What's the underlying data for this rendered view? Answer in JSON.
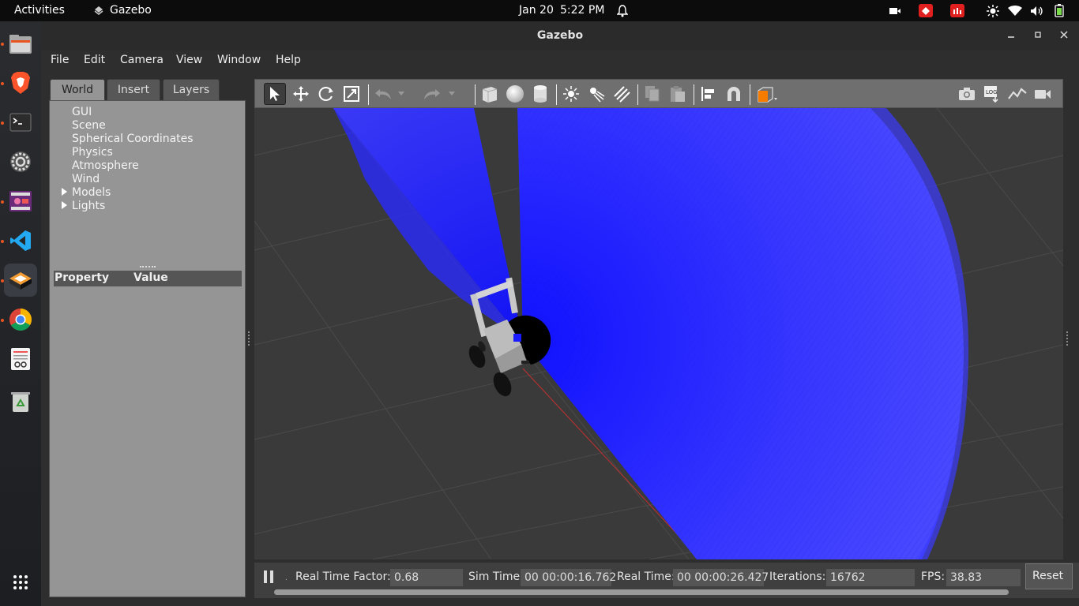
{
  "topbar": {
    "activities": "Activities",
    "app_name": "Gazebo",
    "date": "Jan 20",
    "time": "5:22 PM"
  },
  "window": {
    "title": "Gazebo"
  },
  "menu": {
    "file": "File",
    "edit": "Edit",
    "camera": "Camera",
    "view": "View",
    "window": "Window",
    "help": "Help"
  },
  "tabs": {
    "world": "World",
    "insert": "Insert",
    "layers": "Layers"
  },
  "tree": {
    "gui": "GUI",
    "scene": "Scene",
    "spherical": "Spherical Coordinates",
    "physics": "Physics",
    "atmosphere": "Atmosphere",
    "wind": "Wind",
    "models": "Models",
    "lights": "Lights"
  },
  "properties": {
    "property": "Property",
    "value": "Value"
  },
  "status": {
    "rtf_label": "Real Time Factor:",
    "rtf_value": "0.68",
    "sim_label": "Sim Time:",
    "sim_value": "00 00:00:16.762",
    "real_label": "Real Time:",
    "real_value": "00 00:00:26.427",
    "iter_label": "Iterations:",
    "iter_value": "16762",
    "fps_label": "FPS:",
    "fps_value": "38.83",
    "reset": "Reset"
  },
  "colors": {
    "laser": "#1a1aff",
    "accent": "#e95420",
    "viewport": "#3a3a3a"
  }
}
